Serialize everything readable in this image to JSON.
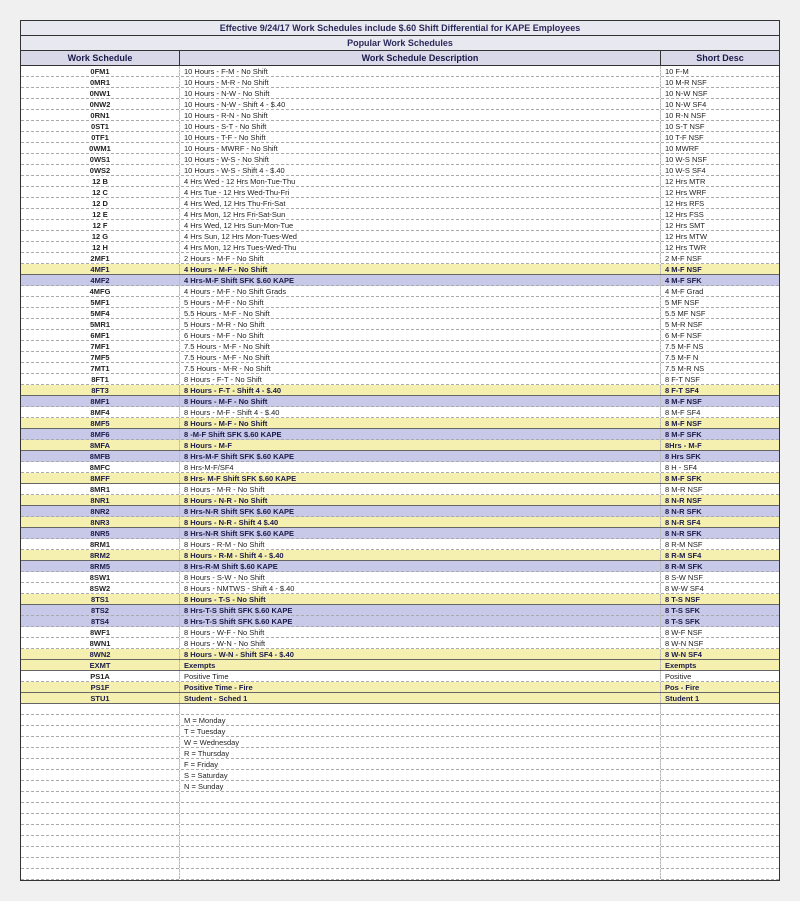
{
  "title": "Effective 9/24/17 Work Schedules include $.60 Shift Differential for KAPE Employees",
  "subtitle": "Popular Work Schedules",
  "headers": {
    "c1": "Work Schedule",
    "c2": "Work Schedule Description",
    "c3": "Short Desc"
  },
  "rows": [
    {
      "c1": "0FM1",
      "c2": "10 Hours - F-M - No Shift",
      "c3": "10 F-M"
    },
    {
      "c1": "0MR1",
      "c2": "10 Hours - M-R - No Shift",
      "c3": "10 M-R NSF"
    },
    {
      "c1": "0NW1",
      "c2": "10 Hours - N-W - No Shift",
      "c3": "10 N-W NSF"
    },
    {
      "c1": "0NW2",
      "c2": "10 Hours - N-W - Shift 4 - $.40",
      "c3": "10 N-W SF4"
    },
    {
      "c1": "0RN1",
      "c2": "10 Hours - R-N - No Shift",
      "c3": "10 R-N NSF"
    },
    {
      "c1": "0ST1",
      "c2": "10 Hours - S-T - No Shift",
      "c3": "10 S-T NSF"
    },
    {
      "c1": "0TF1",
      "c2": "10 Hours - T-F - No Shift",
      "c3": "10 T-F NSF"
    },
    {
      "c1": "0WM1",
      "c2": "10 Hours - MWRF - No Shift",
      "c3": "10 MWRF"
    },
    {
      "c1": "0WS1",
      "c2": "10 Hours - W-S - No Shift",
      "c3": "10 W-S NSF"
    },
    {
      "c1": "0WS2",
      "c2": "10 Hours - W-S - Shift 4 - $.40",
      "c3": "10 W-S SF4"
    },
    {
      "c1": "12 B",
      "c2": "4 Hrs Wed - 12 Hrs Mon-Tue-Thu",
      "c3": "12 Hrs MTR"
    },
    {
      "c1": "12 C",
      "c2": "4 Hrs Tue - 12 Hrs Wed-Thu-Fri",
      "c3": "12 Hrs WRF"
    },
    {
      "c1": "12 D",
      "c2": "4 Hrs Wed, 12 Hrs Thu-Fri-Sat",
      "c3": "12 Hrs RFS"
    },
    {
      "c1": "12 E",
      "c2": "4 Hrs Mon, 12 Hrs Fri-Sat-Sun",
      "c3": "12 Hrs FSS"
    },
    {
      "c1": "12 F",
      "c2": "4 Hrs Wed, 12 Hrs Sun-Mon-Tue",
      "c3": "12 Hrs SMT"
    },
    {
      "c1": "12 G",
      "c2": "4 Hrs Sun, 12 Hrs Mon-Tues-Wed",
      "c3": "12 Hrs MTW"
    },
    {
      "c1": "12 H",
      "c2": "4 Hrs Mon, 12 Hrs Tues-Wed-Thu",
      "c3": "12 Hrs TWR"
    },
    {
      "c1": "2MF1",
      "c2": "2 Hours - M-F - No Shift",
      "c3": "2 M-F NSF"
    },
    {
      "hdr": true,
      "c1": "4MF1",
      "c2": "4 Hours - M-F - No Shift",
      "c3": "4 M-F NSF"
    },
    {
      "hl": true,
      "c1": "4MF2",
      "c2": "4 Hrs-M-F Shift SFK $.60 KAPE",
      "c3": "4 M-F SFK"
    },
    {
      "c1": "4MFG",
      "c2": "4 Hours - M-F - No Shift Grads",
      "c3": "4 M-F Grad"
    },
    {
      "c1": "5MF1",
      "c2": "5 Hours - M-F - No Shift",
      "c3": "5 MF NSF"
    },
    {
      "c1": "5MF4",
      "c2": "5.5 Hours - M-F - No Shift",
      "c3": "5.5 MF NSF"
    },
    {
      "c1": "5MR1",
      "c2": "5 Hours - M-R - No Shift",
      "c3": "5 M-R NSF"
    },
    {
      "c1": "6MF1",
      "c2": "6 Hours - M-F - No Shift",
      "c3": "6 M-F NSF"
    },
    {
      "c1": "7MF1",
      "c2": "7.5 Hours - M-F - No Shift",
      "c3": "7.5 M-F NS"
    },
    {
      "c1": "7MF5",
      "c2": "7.5 Hours - M-F - No Shift",
      "c3": "7.5 M-F N"
    },
    {
      "c1": "7MT1",
      "c2": "7.5 Hours - M-R - No Shift",
      "c3": "7.5 M-R NS"
    },
    {
      "c1": "8FT1",
      "c2": "8 Hours - F-T - No Shift",
      "c3": "8 F-T NSF"
    },
    {
      "hdr": true,
      "c1": "8FT3",
      "c2": "8 Hours - F-T - Shift 4 - $.40",
      "c3": "8 F-T SF4"
    },
    {
      "hl": true,
      "c1": "8MF1",
      "c2": "8 Hours - M-F - No Shift",
      "c3": "8 M-F NSF"
    },
    {
      "c1": "8MF4",
      "c2": "8 Hours - M-F - Shift 4 - $.40",
      "c3": "8 M-F SF4"
    },
    {
      "hdr": true,
      "c1": "8MF5",
      "c2": "8 Hours - M-F - No Shift",
      "c3": "8 M-F NSF"
    },
    {
      "hl": true,
      "c1": "8MF6",
      "c2": "8 -M-F Shift SFK $.60 KAPE",
      "c3": "8 M-F SFK"
    },
    {
      "hdr": true,
      "c1": "8MFA",
      "c2": "8 Hours - M-F",
      "c3": "8Hrs - M-F"
    },
    {
      "hl": true,
      "c1": "8MFB",
      "c2": "8 Hrs-M-F Shift SFK $.60 KAPE",
      "c3": "8 Hrs SFK"
    },
    {
      "c1": "8MFC",
      "c2": "8 Hrs-M-F/SF4",
      "c3": "8 H - SF4"
    },
    {
      "hdr": true,
      "c1": "8MFF",
      "c2": "8 Hrs- M-F Shift SFK $.60 KAPE",
      "c3": "8 M-F SFK"
    },
    {
      "c1": "8MR1",
      "c2": "8 Hours - M-R - No Shift",
      "c3": "8 M-R NSF"
    },
    {
      "hdr": true,
      "c1": "8NR1",
      "c2": "8 Hours - N-R - No Shift",
      "c3": "8 N-R NSF"
    },
    {
      "hl": true,
      "c1": "8NR2",
      "c2": "8 Hrs-N-R Shift SFK $.60 KAPE",
      "c3": "8 N-R SFK"
    },
    {
      "hdr": true,
      "c1": "8NR3",
      "c2": "8 Hours - N-R - Shift 4 $.40",
      "c3": "8 N-R SF4"
    },
    {
      "hl": true,
      "c1": "8NR5",
      "c2": "8 Hrs-N-R Shift SFK $.60 KAPE",
      "c3": "8 N-R SFK"
    },
    {
      "c1": "8RM1",
      "c2": "8 Hours - R-M - No Shift",
      "c3": "8 R-M NSF"
    },
    {
      "hdr": true,
      "c1": "8RM2",
      "c2": "8 Hours - R-M - Shift 4 - $.40",
      "c3": "8 R-M SF4"
    },
    {
      "hl": true,
      "c1": "8RM5",
      "c2": "8 Hrs-R-M Shift $.60 KAPE",
      "c3": "8 R-M SFK"
    },
    {
      "c1": "8SW1",
      "c2": "8 Hours - S-W - No Shift",
      "c3": "8 S-W NSF"
    },
    {
      "c1": "8SW2",
      "c2": "8 Hours - NMTWS - Shift 4 - $.40",
      "c3": "8 W-W SF4"
    },
    {
      "hdr": true,
      "c1": "8TS1",
      "c2": "8 Hours - T-S - No Shift",
      "c3": "8 T-S NSF"
    },
    {
      "hl": true,
      "c1": "8TS2",
      "c2": "8 Hrs-T-S Shift SFK $.60 KAPE",
      "c3": "8 T-S SFK"
    },
    {
      "hl": true,
      "c1": "8TS4",
      "c2": "8 Hrs-T-S Shift SFK $.60 KAPE",
      "c3": "8 T-S SFK"
    },
    {
      "c1": "8WF1",
      "c2": "8 Hours - W-F - No Shift",
      "c3": "8 W-F NSF"
    },
    {
      "c1": "8WN1",
      "c2": "8 Hours - W-N - No Shift",
      "c3": "8 W-N NSF"
    },
    {
      "hdr": true,
      "c1": "8WN2",
      "c2": "8 Hours - W-N - Shift SF4 - $.40",
      "c3": "8 W-N SF4"
    },
    {
      "hdr": true,
      "c1": "EXMT",
      "c2": "Exempts",
      "c3": "Exempts"
    },
    {
      "c1": "PS1A",
      "c2": "Positive Time",
      "c3": "Positive"
    },
    {
      "hdr": true,
      "c1": "PS1F",
      "c2": "Positive Time - Fire",
      "c3": "Pos - Fire"
    },
    {
      "hdr": true,
      "c1": "STU1",
      "c2": "Student - Sched 1",
      "c3": "Student 1"
    }
  ],
  "legend": [
    "M = Monday",
    "T = Tuesday",
    "W = Wednesday",
    "R = Thursday",
    "F = Friday",
    "S = Saturday",
    "N = Sunday"
  ],
  "blank_rows_after_legend": 8
}
